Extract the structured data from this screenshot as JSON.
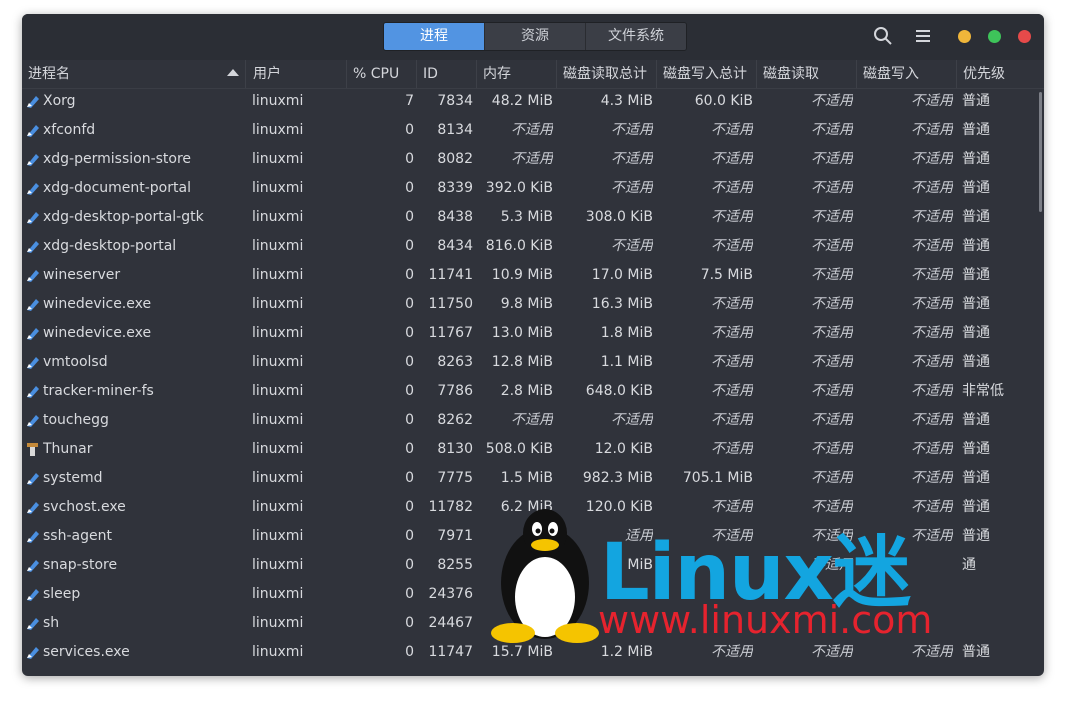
{
  "tabs": [
    "进程",
    "资源",
    "文件系统"
  ],
  "columns": [
    "进程名",
    "用户",
    "% CPU",
    "ID",
    "内存",
    "磁盘读取总计",
    "磁盘写入总计",
    "磁盘读取",
    "磁盘写入",
    "优先级"
  ],
  "rows": [
    {
      "name": "Xorg",
      "user": "linuxmi",
      "cpu": "7",
      "id": "7834",
      "mem": "48.2 MiB",
      "dr_total": "4.3 MiB",
      "dw_total": "60.0 KiB",
      "dr": "不适用",
      "dw": "不适用",
      "pri": "普通",
      "icon": "wine-icon"
    },
    {
      "name": "xfconfd",
      "user": "linuxmi",
      "cpu": "0",
      "id": "8134",
      "mem": "不适用",
      "dr_total": "不适用",
      "dw_total": "不适用",
      "dr": "不适用",
      "dw": "不适用",
      "pri": "普通",
      "icon": "wine-icon"
    },
    {
      "name": "xdg-permission-store",
      "user": "linuxmi",
      "cpu": "0",
      "id": "8082",
      "mem": "不适用",
      "dr_total": "不适用",
      "dw_total": "不适用",
      "dr": "不适用",
      "dw": "不适用",
      "pri": "普通",
      "icon": "wine-icon"
    },
    {
      "name": "xdg-document-portal",
      "user": "linuxmi",
      "cpu": "0",
      "id": "8339",
      "mem": "392.0 KiB",
      "dr_total": "不适用",
      "dw_total": "不适用",
      "dr": "不适用",
      "dw": "不适用",
      "pri": "普通",
      "icon": "wine-icon"
    },
    {
      "name": "xdg-desktop-portal-gtk",
      "user": "linuxmi",
      "cpu": "0",
      "id": "8438",
      "mem": "5.3 MiB",
      "dr_total": "308.0 KiB",
      "dw_total": "不适用",
      "dr": "不适用",
      "dw": "不适用",
      "pri": "普通",
      "icon": "wine-icon"
    },
    {
      "name": "xdg-desktop-portal",
      "user": "linuxmi",
      "cpu": "0",
      "id": "8434",
      "mem": "816.0 KiB",
      "dr_total": "不适用",
      "dw_total": "不适用",
      "dr": "不适用",
      "dw": "不适用",
      "pri": "普通",
      "icon": "wine-icon"
    },
    {
      "name": "wineserver",
      "user": "linuxmi",
      "cpu": "0",
      "id": "11741",
      "mem": "10.9 MiB",
      "dr_total": "17.0 MiB",
      "dw_total": "7.5 MiB",
      "dr": "不适用",
      "dw": "不适用",
      "pri": "普通",
      "icon": "wine-icon"
    },
    {
      "name": "winedevice.exe",
      "user": "linuxmi",
      "cpu": "0",
      "id": "11750",
      "mem": "9.8 MiB",
      "dr_total": "16.3 MiB",
      "dw_total": "不适用",
      "dr": "不适用",
      "dw": "不适用",
      "pri": "普通",
      "icon": "wine-icon"
    },
    {
      "name": "winedevice.exe",
      "user": "linuxmi",
      "cpu": "0",
      "id": "11767",
      "mem": "13.0 MiB",
      "dr_total": "1.8 MiB",
      "dw_total": "不适用",
      "dr": "不适用",
      "dw": "不适用",
      "pri": "普通",
      "icon": "wine-icon"
    },
    {
      "name": "vmtoolsd",
      "user": "linuxmi",
      "cpu": "0",
      "id": "8263",
      "mem": "12.8 MiB",
      "dr_total": "1.1 MiB",
      "dw_total": "不适用",
      "dr": "不适用",
      "dw": "不适用",
      "pri": "普通",
      "icon": "wine-icon"
    },
    {
      "name": "tracker-miner-fs",
      "user": "linuxmi",
      "cpu": "0",
      "id": "7786",
      "mem": "2.8 MiB",
      "dr_total": "648.0 KiB",
      "dw_total": "不适用",
      "dr": "不适用",
      "dw": "不适用",
      "pri": "非常低",
      "icon": "wine-icon"
    },
    {
      "name": "touchegg",
      "user": "linuxmi",
      "cpu": "0",
      "id": "8262",
      "mem": "不适用",
      "dr_total": "不适用",
      "dw_total": "不适用",
      "dr": "不适用",
      "dw": "不适用",
      "pri": "普通",
      "icon": "wine-icon"
    },
    {
      "name": "Thunar",
      "user": "linuxmi",
      "cpu": "0",
      "id": "8130",
      "mem": "508.0 KiB",
      "dr_total": "12.0 KiB",
      "dw_total": "不适用",
      "dr": "不适用",
      "dw": "不适用",
      "pri": "普通",
      "icon": "thunar-icon"
    },
    {
      "name": "systemd",
      "user": "linuxmi",
      "cpu": "0",
      "id": "7775",
      "mem": "1.5 MiB",
      "dr_total": "982.3 MiB",
      "dw_total": "705.1 MiB",
      "dr": "不适用",
      "dw": "不适用",
      "pri": "普通",
      "icon": "wine-icon"
    },
    {
      "name": "svchost.exe",
      "user": "linuxmi",
      "cpu": "0",
      "id": "11782",
      "mem": "6.2 MiB",
      "dr_total": "120.0 KiB",
      "dw_total": "不适用",
      "dr": "不适用",
      "dw": "不适用",
      "pri": "普通",
      "icon": "wine-icon"
    },
    {
      "name": "ssh-agent",
      "user": "linuxmi",
      "cpu": "0",
      "id": "7971",
      "mem": "32.",
      "dr_total": "适用",
      "dw_total": "不适用",
      "dr": "不适用",
      "dw": "不适用",
      "pri": "普通",
      "icon": "wine-icon"
    },
    {
      "name": "snap-store",
      "user": "linuxmi",
      "cpu": "0",
      "id": "8255",
      "mem": "3",
      "dr_total": "MiB",
      "dw_total": "",
      "dr": "不适用",
      "dw": "",
      "pri": "通",
      "icon": "wine-icon"
    },
    {
      "name": "sleep",
      "user": "linuxmi",
      "cpu": "0",
      "id": "24376",
      "mem": "",
      "dr_total": "",
      "dw_total": "",
      "dr": "",
      "dw": "",
      "pri": "",
      "icon": "wine-icon"
    },
    {
      "name": "sh",
      "user": "linuxmi",
      "cpu": "0",
      "id": "24467",
      "mem": "",
      "dr_total": "",
      "dw_total": "",
      "dr": "",
      "dw": "",
      "pri": "",
      "icon": "wine-icon"
    },
    {
      "name": "services.exe",
      "user": "linuxmi",
      "cpu": "0",
      "id": "11747",
      "mem": "15.7 MiB",
      "dr_total": "1.2 MiB",
      "dw_total": "不适用",
      "dr": "不适用",
      "dw": "不适用",
      "pri": "普通",
      "icon": "wine-icon"
    }
  ],
  "watermark": {
    "logo": "Linux迷",
    "url": "www.linuxmi.com"
  },
  "colors": {
    "accent": "#5294e2",
    "window_bg": "#30333b",
    "close": "#e64a4a",
    "minimize": "#f0b63a",
    "maximize": "#3ec45a"
  }
}
